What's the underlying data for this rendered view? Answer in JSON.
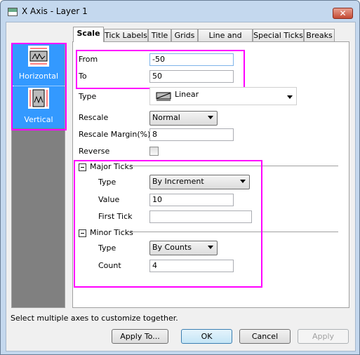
{
  "window": {
    "title": "X Axis - Layer 1",
    "close_label": "✕"
  },
  "tabs": [
    "Scale",
    "Tick Labels",
    "Title",
    "Grids",
    "Line and Ticks",
    "Special Ticks",
    "Breaks"
  ],
  "sidebar": {
    "items": [
      {
        "label": "Horizontal",
        "icon": "horizontal-axis-icon"
      },
      {
        "label": "Vertical",
        "icon": "vertical-axis-icon"
      }
    ]
  },
  "scale": {
    "from_label": "From",
    "from_value": "-50",
    "to_label": "To",
    "to_value": "50",
    "type_label": "Type",
    "type_value": "Linear",
    "rescale_label": "Rescale",
    "rescale_value": "Normal",
    "margin_label": "Rescale Margin(%)",
    "margin_value": "8",
    "reverse_label": "Reverse",
    "reverse_checked": false
  },
  "major": {
    "header": "Major Ticks",
    "type_label": "Type",
    "type_value": "By Increment",
    "value_label": "Value",
    "value": "10",
    "first_label": "First Tick",
    "first_value": ""
  },
  "minor": {
    "header": "Minor Ticks",
    "type_label": "Type",
    "type_value": "By Counts",
    "count_label": "Count",
    "count": "4"
  },
  "status": "Select multiple axes to customize together.",
  "buttons": {
    "apply_to": "Apply To...",
    "ok": "OK",
    "cancel": "Cancel",
    "apply": "Apply"
  },
  "colors": {
    "highlight": "#ff00ff",
    "selection": "#3399ff"
  }
}
